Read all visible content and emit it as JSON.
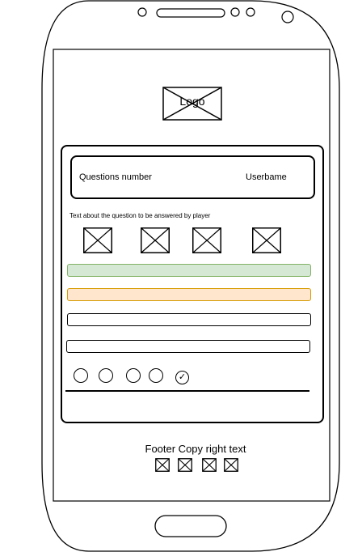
{
  "logo": {
    "label": "Logo"
  },
  "header": {
    "questions_number": "Questions number",
    "username": "Userbame"
  },
  "question": {
    "text": "Text about the question to be answered by player",
    "image_count": 4
  },
  "answers": [
    {
      "state": "correct",
      "color": "#d5e8d4",
      "stroke": "#82b366"
    },
    {
      "state": "wrong",
      "color": "#ffe6cc",
      "stroke": "#d79b00"
    },
    {
      "state": "neutral"
    },
    {
      "state": "neutral"
    }
  ],
  "progress": {
    "total": 5,
    "checked_index": 4,
    "check_glyph": "✓"
  },
  "footer": {
    "text": "Footer Copy right text",
    "icon_count": 4
  }
}
